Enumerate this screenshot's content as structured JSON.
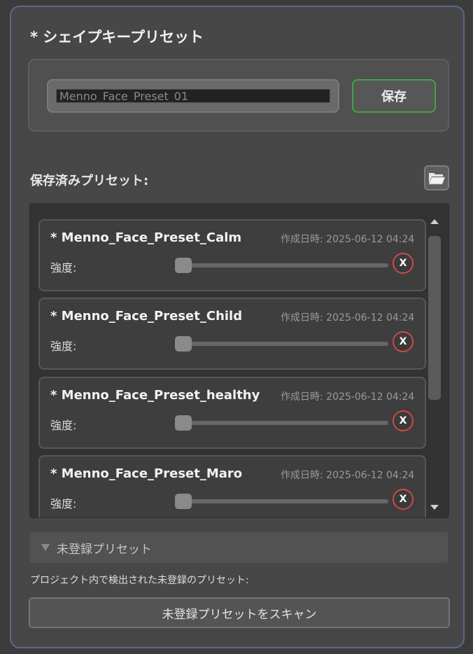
{
  "title": "* シェイプキープリセット",
  "preset_name_input": {
    "value": "Menno_Face_Preset_01"
  },
  "save_button_label": "保存",
  "saved_presets_label": "保存済みプリセット:",
  "folder_icon": "folder-open-icon",
  "presets": [
    {
      "name": "* Menno_Face_Preset_Calm",
      "date": "作成日時: 2025-06-12 04:24",
      "strength_label": "強度:",
      "strength": 0,
      "delete_label": "X"
    },
    {
      "name": "* Menno_Face_Preset_Child",
      "date": "作成日時: 2025-06-12 04:24",
      "strength_label": "強度:",
      "strength": 0,
      "delete_label": "X"
    },
    {
      "name": "* Menno_Face_Preset_healthy",
      "date": "作成日時: 2025-06-12 04:24",
      "strength_label": "強度:",
      "strength": 0,
      "delete_label": "X"
    },
    {
      "name": "* Menno_Face_Preset_Maro",
      "date": "作成日時: 2025-06-12 04:24",
      "strength_label": "強度:",
      "strength": 0,
      "delete_label": "X"
    }
  ],
  "unregistered_foldout_label": "未登録プリセット",
  "detected_label": "プロジェクト内で検出された未登録のプリセット:",
  "scan_button_label": "未登録プリセットをスキャン",
  "colors": {
    "accent_save": "#3ea54a",
    "delete": "#d04848",
    "panel_border": "#5a6a8c"
  }
}
